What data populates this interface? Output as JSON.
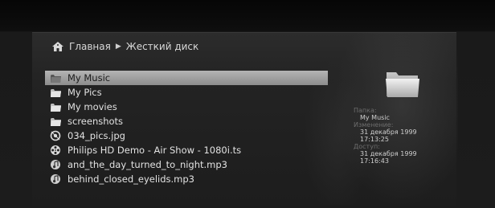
{
  "breadcrumb": {
    "home": "Главная",
    "current": "Жесткий диск"
  },
  "files": [
    {
      "name": "My Music",
      "icon": "folder-icon",
      "selected": true
    },
    {
      "name": "My Pics",
      "icon": "folder-icon",
      "selected": false
    },
    {
      "name": "My movies",
      "icon": "folder-icon",
      "selected": false
    },
    {
      "name": "screenshots",
      "icon": "folder-icon",
      "selected": false
    },
    {
      "name": "034_pics.jpg",
      "icon": "image-file-icon",
      "selected": false
    },
    {
      "name": "Philips HD Demo - Air Show - 1080i.ts",
      "icon": "film-reel-icon",
      "selected": false
    },
    {
      "name": "and_the_day_turned_to_night.mp3",
      "icon": "music-file-icon",
      "selected": false
    },
    {
      "name": "behind_closed_eyelids.mp3",
      "icon": "music-file-icon",
      "selected": false
    }
  ],
  "info": {
    "folder_label": "Папка:",
    "folder_value": "My Music",
    "modified_label": "Изменение:",
    "modified_date": "31 декабря 1999",
    "modified_time": "17:13:25",
    "access_label": "Доступ:",
    "access_date": "31 декабря 1999",
    "access_time": "17:16:43"
  },
  "colors": {
    "selection": "#a0a0a0",
    "text": "#e2e2e2",
    "muted": "#6d6d6d"
  }
}
